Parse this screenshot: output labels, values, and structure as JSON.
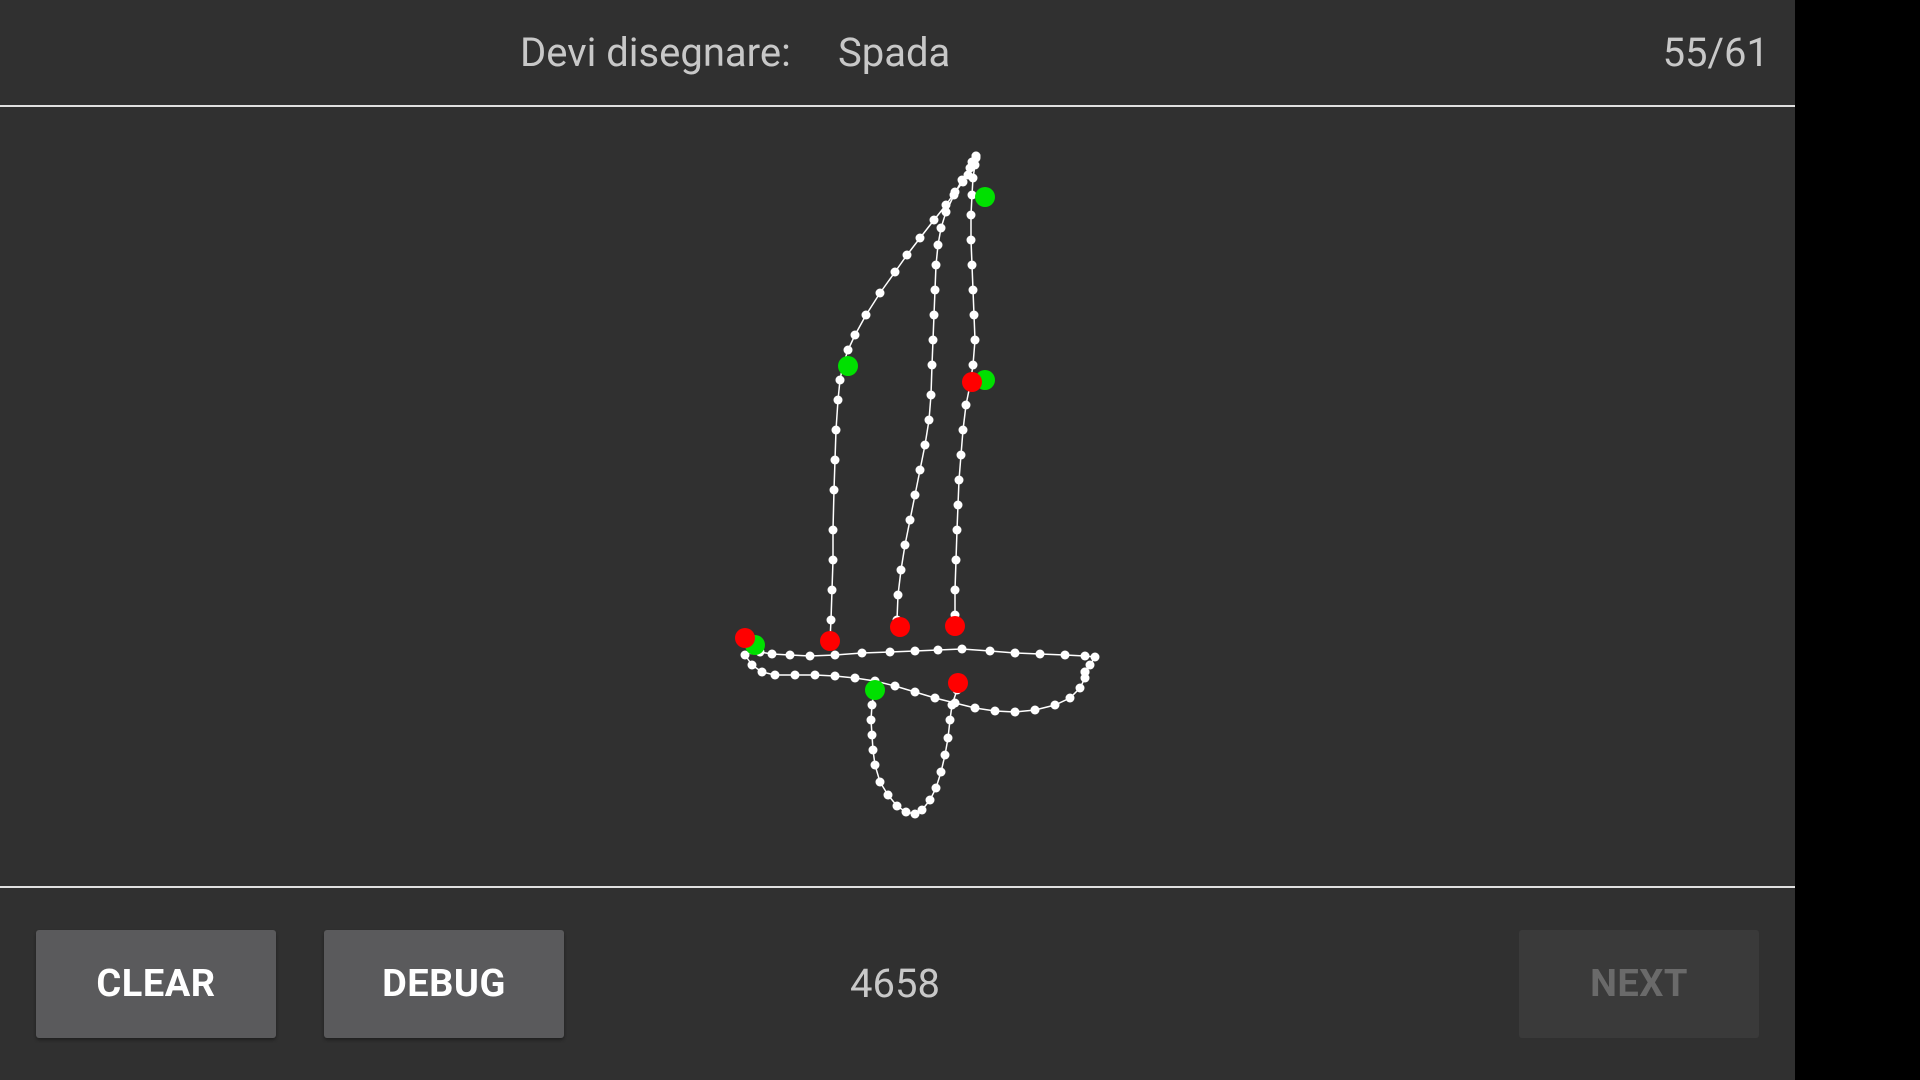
{
  "header": {
    "prompt_label": "Devi disegnare:",
    "prompt_word": "Spada",
    "progress": "55/61"
  },
  "footer": {
    "clear_label": "CLEAR",
    "debug_label": "DEBUG",
    "score": "4658",
    "next_label": "NEXT",
    "next_enabled": false
  },
  "colors": {
    "background": "#303030",
    "stroke": "#ffffff",
    "start_marker": "#00e000",
    "end_marker": "#ff0000"
  }
}
